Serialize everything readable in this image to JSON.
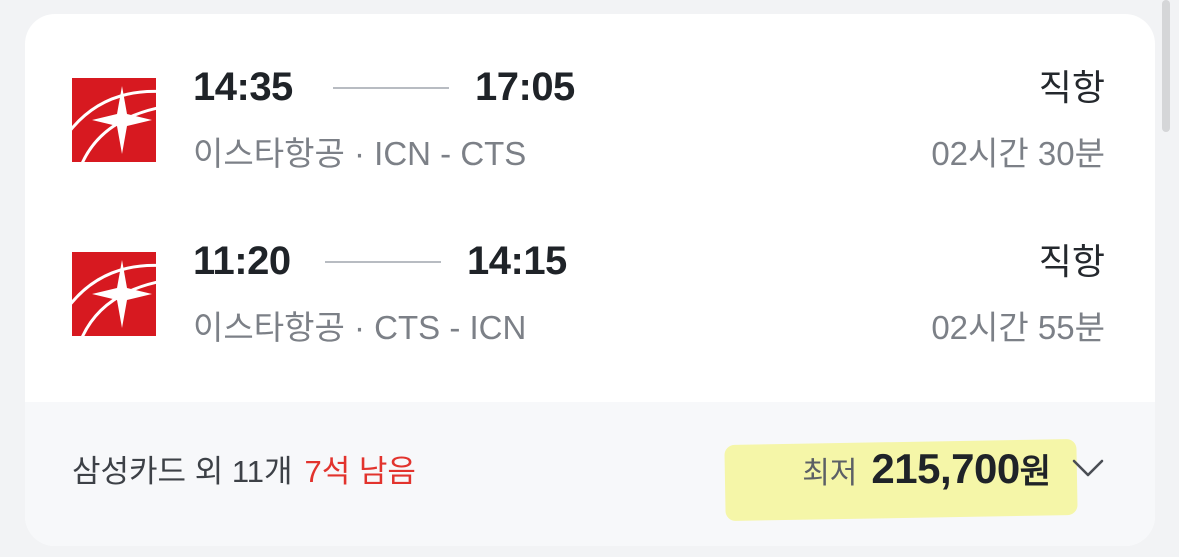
{
  "outbound": {
    "departure_time": "14:35",
    "arrival_time": "17:05",
    "airline": "이스타항공",
    "route": "ICN - CTS",
    "type": "직항",
    "duration": "02시간 30분"
  },
  "inbound": {
    "departure_time": "11:20",
    "arrival_time": "14:15",
    "airline": "이스타항공",
    "route": "CTS - ICN",
    "type": "직항",
    "duration": "02시간 55분"
  },
  "route_separator": "·",
  "footer": {
    "card_offers": "삼성카드 외 11개",
    "seats_left": "7석 남음",
    "price_label": "최저",
    "price_value": "215,700",
    "price_unit": "원"
  },
  "colors": {
    "airline_logo": "#d71920",
    "seats_left": "#e2332d",
    "highlight": "#f5f6a8"
  },
  "icons": {
    "airline_logo": "eastar-jet-logo-icon",
    "expand": "chevron-down-icon"
  }
}
